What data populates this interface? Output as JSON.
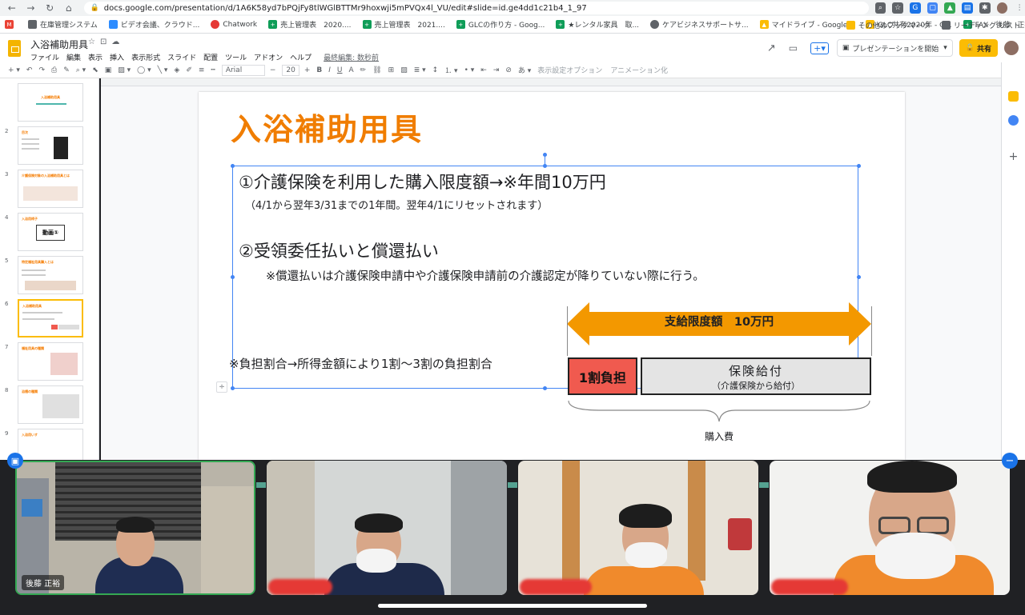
{
  "browser": {
    "url": "docs.google.com/presentation/d/1A6K58yd7bPQjFy8tlWGlBTTMr9hoxwji5mPVQx4l_VU/edit#slide=id.ge4dd1c21b4_1_97",
    "bookmarks": [
      "在庫管理システム",
      "ビデオ会議、クラウド...",
      "Chatwork",
      "売上管理表　2020....",
      "売上管理表　2021....",
      "GLCの作り方 - Goog...",
      "★レンタル家具　取...",
      "ケアビジネスサポートサ...",
      "マイドライブ - Google...",
      "GLC共有2020年 - G...",
      "FAX　後藤　正裕 -..."
    ],
    "bookmarks_right": [
      "その他のブックマーク",
      "リーディング リスト"
    ],
    "colors": {
      "gmail": "#ea4335",
      "accent": "#1a73e8"
    }
  },
  "header": {
    "title": "入浴補助用具",
    "menu": [
      "ファイル",
      "編集",
      "表示",
      "挿入",
      "表示形式",
      "スライド",
      "配置",
      "ツール",
      "アドオン",
      "ヘルプ"
    ],
    "last_edit": "最終編集: 数秒前",
    "present_label": "プレゼンテーションを開始",
    "share_label": "共有"
  },
  "toolbar": {
    "font": "Arial",
    "font_size": "20",
    "format_options": "表示設定オプション",
    "animation": "アニメーション化"
  },
  "filmstrip": {
    "slides": [
      {
        "num": "1",
        "title": "入浴補助用具"
      },
      {
        "num": "2",
        "title": "目次"
      },
      {
        "num": "3",
        "title": "介護保険対象の入浴補助用具とは"
      },
      {
        "num": "4",
        "title": "入浴用椅子"
      },
      {
        "num": "5",
        "title": "特定福祉用具購入とは"
      },
      {
        "num": "6",
        "title": "入浴補助用具"
      },
      {
        "num": "7",
        "title": "福祉用具の種類"
      },
      {
        "num": "8",
        "title": "浴槽の種類"
      },
      {
        "num": "9",
        "title": "入浴用いす"
      }
    ],
    "thumb_video_label": "動画①",
    "selected_index": 5
  },
  "slide": {
    "title": "入浴補助用具",
    "line1": "①介護保険を利用した購入限度額→※年間10万円",
    "line1_sub": "（4/1から翌年3/31までの1年間。翌年4/1にリセットされます）",
    "line2": "②受領委任払いと償還払い",
    "line2_sub": "※償還払いは介護保険申請中や介護保険申請前の介護認定が降りていない際に行う。",
    "ratio_note": "※負担割合→所得金額により1割〜3割の負担割合",
    "arrow_label": "支給限度額　10万円",
    "box_red": "1割負担",
    "box_grey_title": "保険給付",
    "box_grey_sub": "（介護保険から給付）",
    "brace_label": "購入費",
    "colors": {
      "title": "#f07d00",
      "arrow": "#f39800",
      "red": "#f05a4f",
      "grey": "#e4e4e4"
    }
  },
  "meet": {
    "participants": [
      {
        "name": "後藤 正裕",
        "active": true
      },
      {
        "name": "",
        "active": false
      },
      {
        "name": "",
        "active": false
      },
      {
        "name": "",
        "active": false
      }
    ]
  }
}
